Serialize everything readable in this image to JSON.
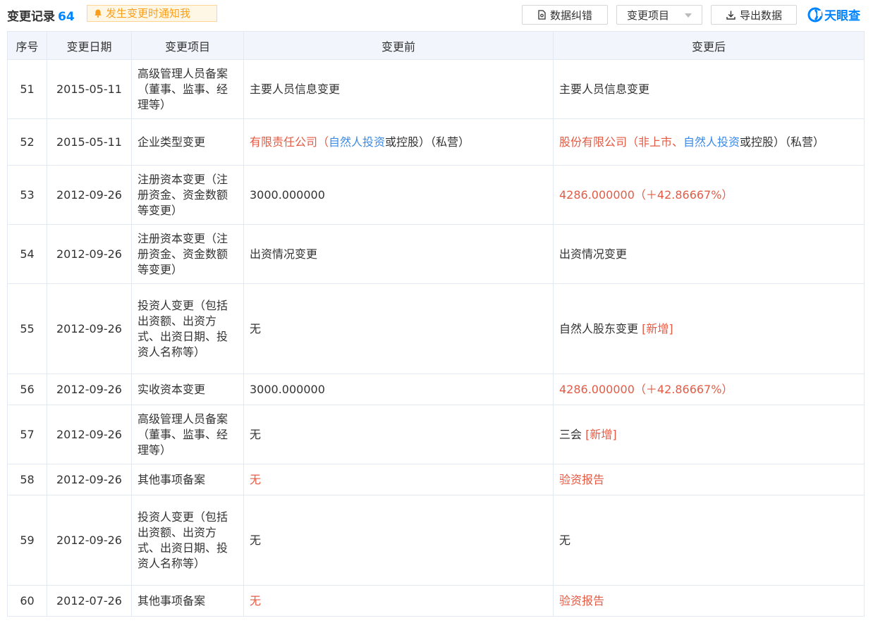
{
  "header": {
    "title": "变更记录",
    "count": "64",
    "notify_label": "发生变更时通知我",
    "buttons": {
      "correct": "数据纠错",
      "filter": "变更项目",
      "export": "导出数据"
    },
    "logo": "天眼查"
  },
  "table": {
    "columns": [
      "序号",
      "变更日期",
      "变更项目",
      "变更前",
      "变更后"
    ],
    "rows": [
      {
        "no": "51",
        "date": "2015-05-11",
        "item": "高级管理人员备案（董事、监事、经理等）",
        "before": [
          {
            "t": "主要人员信息变更",
            "c": ""
          }
        ],
        "after": [
          {
            "t": "主要人员信息变更",
            "c": ""
          }
        ]
      },
      {
        "no": "52",
        "date": "2015-05-11",
        "item": "企业类型变更",
        "before": [
          {
            "t": "有限责任公司（",
            "c": "red"
          },
          {
            "t": "自然人投资",
            "c": "blue"
          },
          {
            "t": "或控股）（私营）",
            "c": ""
          }
        ],
        "after": [
          {
            "t": "股份有限公司（非上市、",
            "c": "red"
          },
          {
            "t": "自然人投资",
            "c": "blue"
          },
          {
            "t": "或控股）（私营）",
            "c": ""
          }
        ]
      },
      {
        "no": "53",
        "date": "2012-09-26",
        "item": "注册资本变更（注册资金、资金数额等变更）",
        "before": [
          {
            "t": "3000.000000",
            "c": ""
          }
        ],
        "after": [
          {
            "t": "4286.000000（＋42.86667%）",
            "c": "red"
          }
        ]
      },
      {
        "no": "54",
        "date": "2012-09-26",
        "item": "注册资本变更（注册资金、资金数额等变更）",
        "before": [
          {
            "t": "出资情况变更",
            "c": ""
          }
        ],
        "after": [
          {
            "t": "出资情况变更",
            "c": ""
          }
        ]
      },
      {
        "no": "55",
        "date": "2012-09-26",
        "item": "投资人变更（包括出资额、出资方式、出资日期、投资人名称等）",
        "before": [
          {
            "t": "无",
            "c": ""
          }
        ],
        "after": [
          {
            "t": "自然人股东变更 ",
            "c": ""
          },
          {
            "t": "[新增]",
            "c": "red"
          }
        ]
      },
      {
        "no": "56",
        "date": "2012-09-26",
        "item": "实收资本变更",
        "before": [
          {
            "t": "3000.000000",
            "c": ""
          }
        ],
        "after": [
          {
            "t": "4286.000000（＋42.86667%）",
            "c": "red"
          }
        ]
      },
      {
        "no": "57",
        "date": "2012-09-26",
        "item": "高级管理人员备案（董事、监事、经理等）",
        "before": [
          {
            "t": "无",
            "c": ""
          }
        ],
        "after": [
          {
            "t": "三会 ",
            "c": ""
          },
          {
            "t": "[新增]",
            "c": "red"
          }
        ]
      },
      {
        "no": "58",
        "date": "2012-09-26",
        "item": "其他事项备案",
        "before": [
          {
            "t": "无",
            "c": "red"
          }
        ],
        "after": [
          {
            "t": "验资报告",
            "c": "red"
          }
        ]
      },
      {
        "no": "59",
        "date": "2012-09-26",
        "item": "投资人变更（包括出资额、出资方式、出资日期、投资人名称等）",
        "before": [
          {
            "t": "无",
            "c": ""
          }
        ],
        "after": [
          {
            "t": "无",
            "c": ""
          }
        ]
      },
      {
        "no": "60",
        "date": "2012-07-26",
        "item": "其他事项备案",
        "before": [
          {
            "t": "无",
            "c": "red"
          }
        ],
        "after": [
          {
            "t": "验资报告",
            "c": "red"
          }
        ]
      }
    ]
  },
  "colors": {
    "accent": "#0084ff",
    "red": "#e35b45",
    "blue": "#3c8ae8",
    "warn": "#fa9f1b"
  }
}
